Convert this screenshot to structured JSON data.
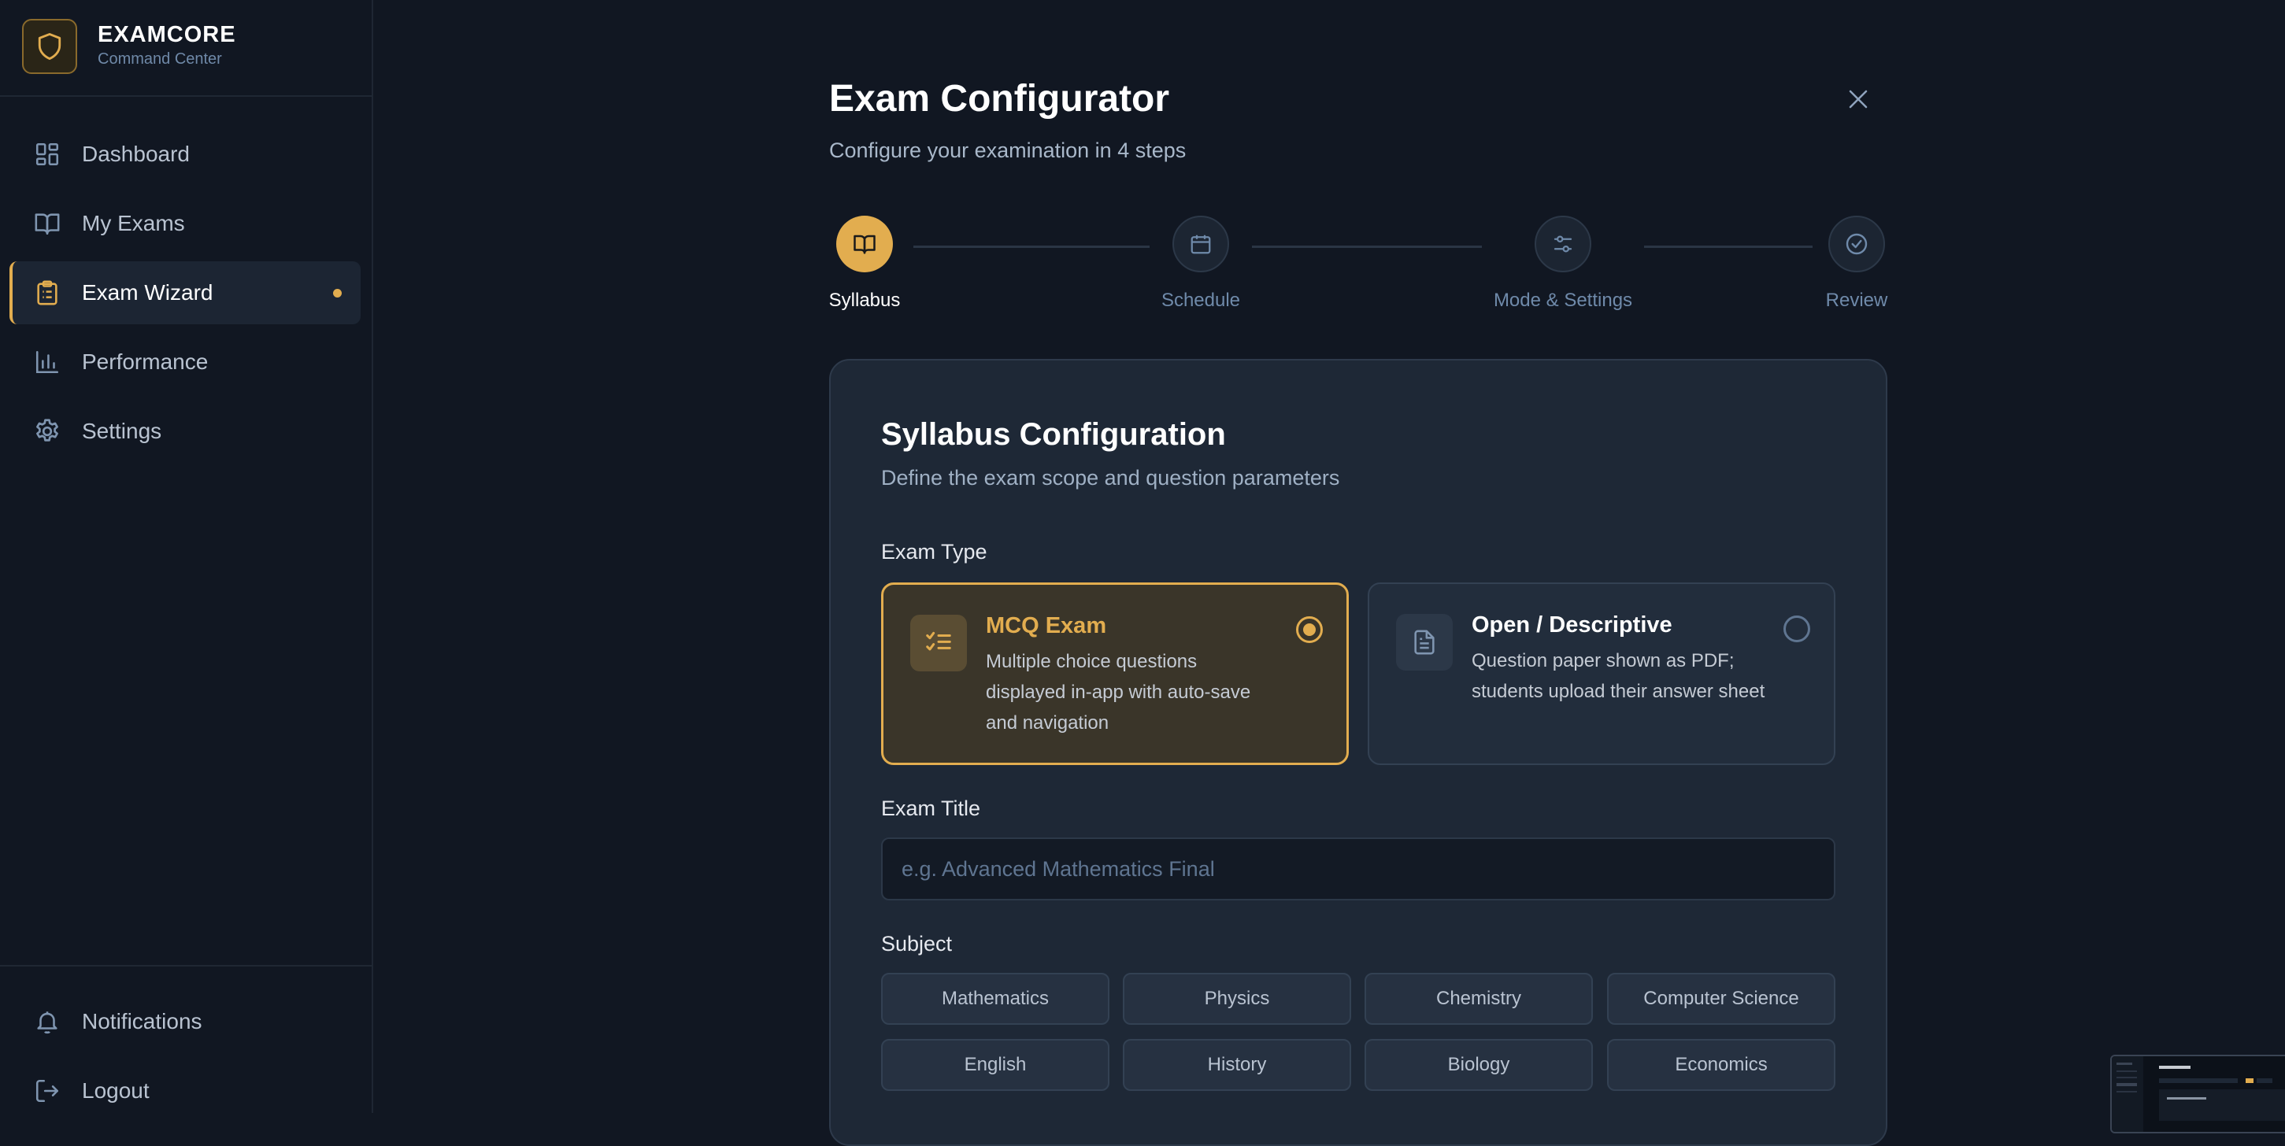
{
  "brand": {
    "title": "EXAMCORE",
    "subtitle": "Command Center"
  },
  "sidebar": {
    "items": [
      {
        "label": "Dashboard",
        "icon": "dashboard-icon"
      },
      {
        "label": "My Exams",
        "icon": "book-open-icon"
      },
      {
        "label": "Exam Wizard",
        "icon": "clipboard-list-icon",
        "active": true
      },
      {
        "label": "Performance",
        "icon": "bar-chart-icon"
      },
      {
        "label": "Settings",
        "icon": "gear-icon"
      }
    ],
    "footer": [
      {
        "label": "Notifications",
        "icon": "bell-icon"
      },
      {
        "label": "Logout",
        "icon": "logout-icon"
      }
    ]
  },
  "header": {
    "title": "Exam Configurator",
    "subtitle": "Configure your examination in 4 steps"
  },
  "steps": [
    {
      "label": "Syllabus",
      "icon": "book-open-icon",
      "active": true
    },
    {
      "label": "Schedule",
      "icon": "calendar-icon"
    },
    {
      "label": "Mode & Settings",
      "icon": "sliders-icon"
    },
    {
      "label": "Review",
      "icon": "check-circle-icon"
    }
  ],
  "card": {
    "title": "Syllabus Configuration",
    "subtitle": "Define the exam scope and question parameters",
    "exam_type_label": "Exam Type",
    "types": [
      {
        "title": "MCQ Exam",
        "description": "Multiple choice questions displayed in-app with auto-save and navigation",
        "selected": true
      },
      {
        "title": "Open / Descriptive",
        "description": "Question paper shown as PDF; students upload their answer sheet",
        "selected": false
      }
    ],
    "exam_title_label": "Exam Title",
    "exam_title_placeholder": "e.g. Advanced Mathematics Final",
    "exam_title_value": "",
    "subject_label": "Subject",
    "subjects": [
      "Mathematics",
      "Physics",
      "Chemistry",
      "Computer Science",
      "English",
      "History",
      "Biology",
      "Economics"
    ]
  },
  "colors": {
    "accent": "#e2ad4f",
    "background": "#111722",
    "card": "#1e2836",
    "muted_text": "#6f8aaa"
  }
}
